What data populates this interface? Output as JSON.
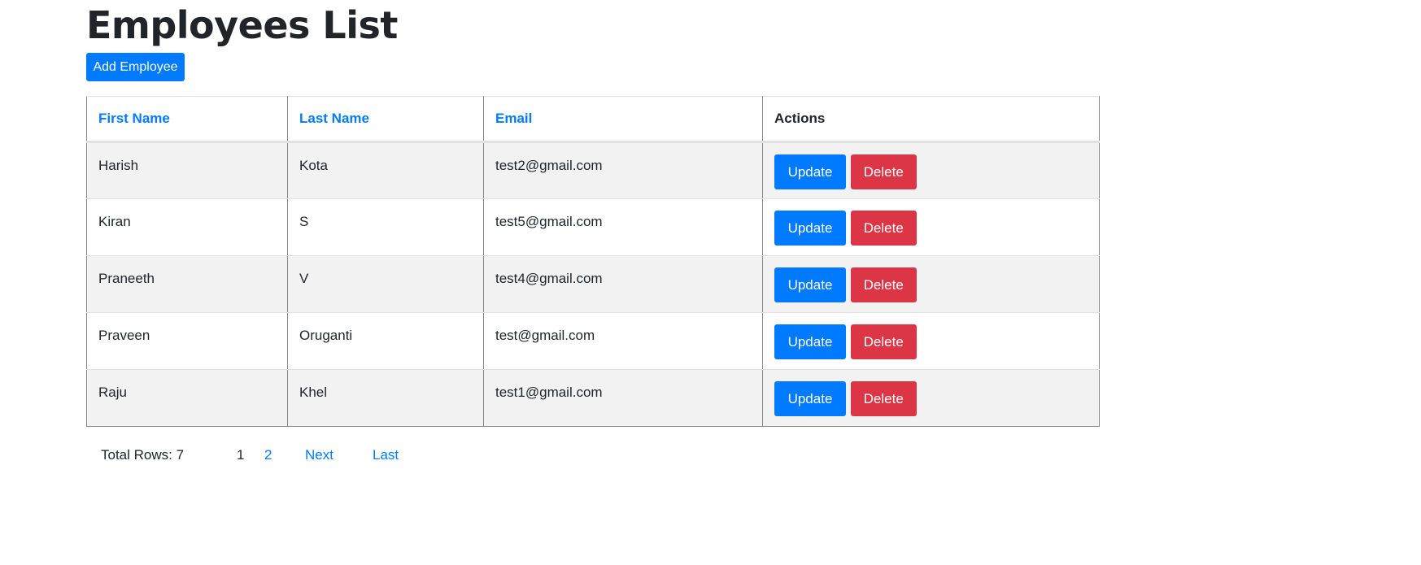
{
  "title": "Employees List",
  "add_label": "Add Employee",
  "columns": [
    "First Name",
    "Last Name",
    "Email",
    "Actions"
  ],
  "rows": [
    {
      "first": "Harish",
      "last": "Kota",
      "email": "test2@gmail.com"
    },
    {
      "first": "Kiran",
      "last": "S",
      "email": "test5@gmail.com"
    },
    {
      "first": "Praneeth",
      "last": "V",
      "email": "test4@gmail.com"
    },
    {
      "first": "Praveen",
      "last": "Oruganti",
      "email": "test@gmail.com"
    },
    {
      "first": "Raju",
      "last": "Khel",
      "email": "test1@gmail.com"
    }
  ],
  "update_label": "Update",
  "delete_label": "Delete",
  "footer": {
    "total": "Total Rows: 7",
    "pages": [
      "1",
      "2"
    ],
    "next": "Next",
    "last": "Last"
  }
}
